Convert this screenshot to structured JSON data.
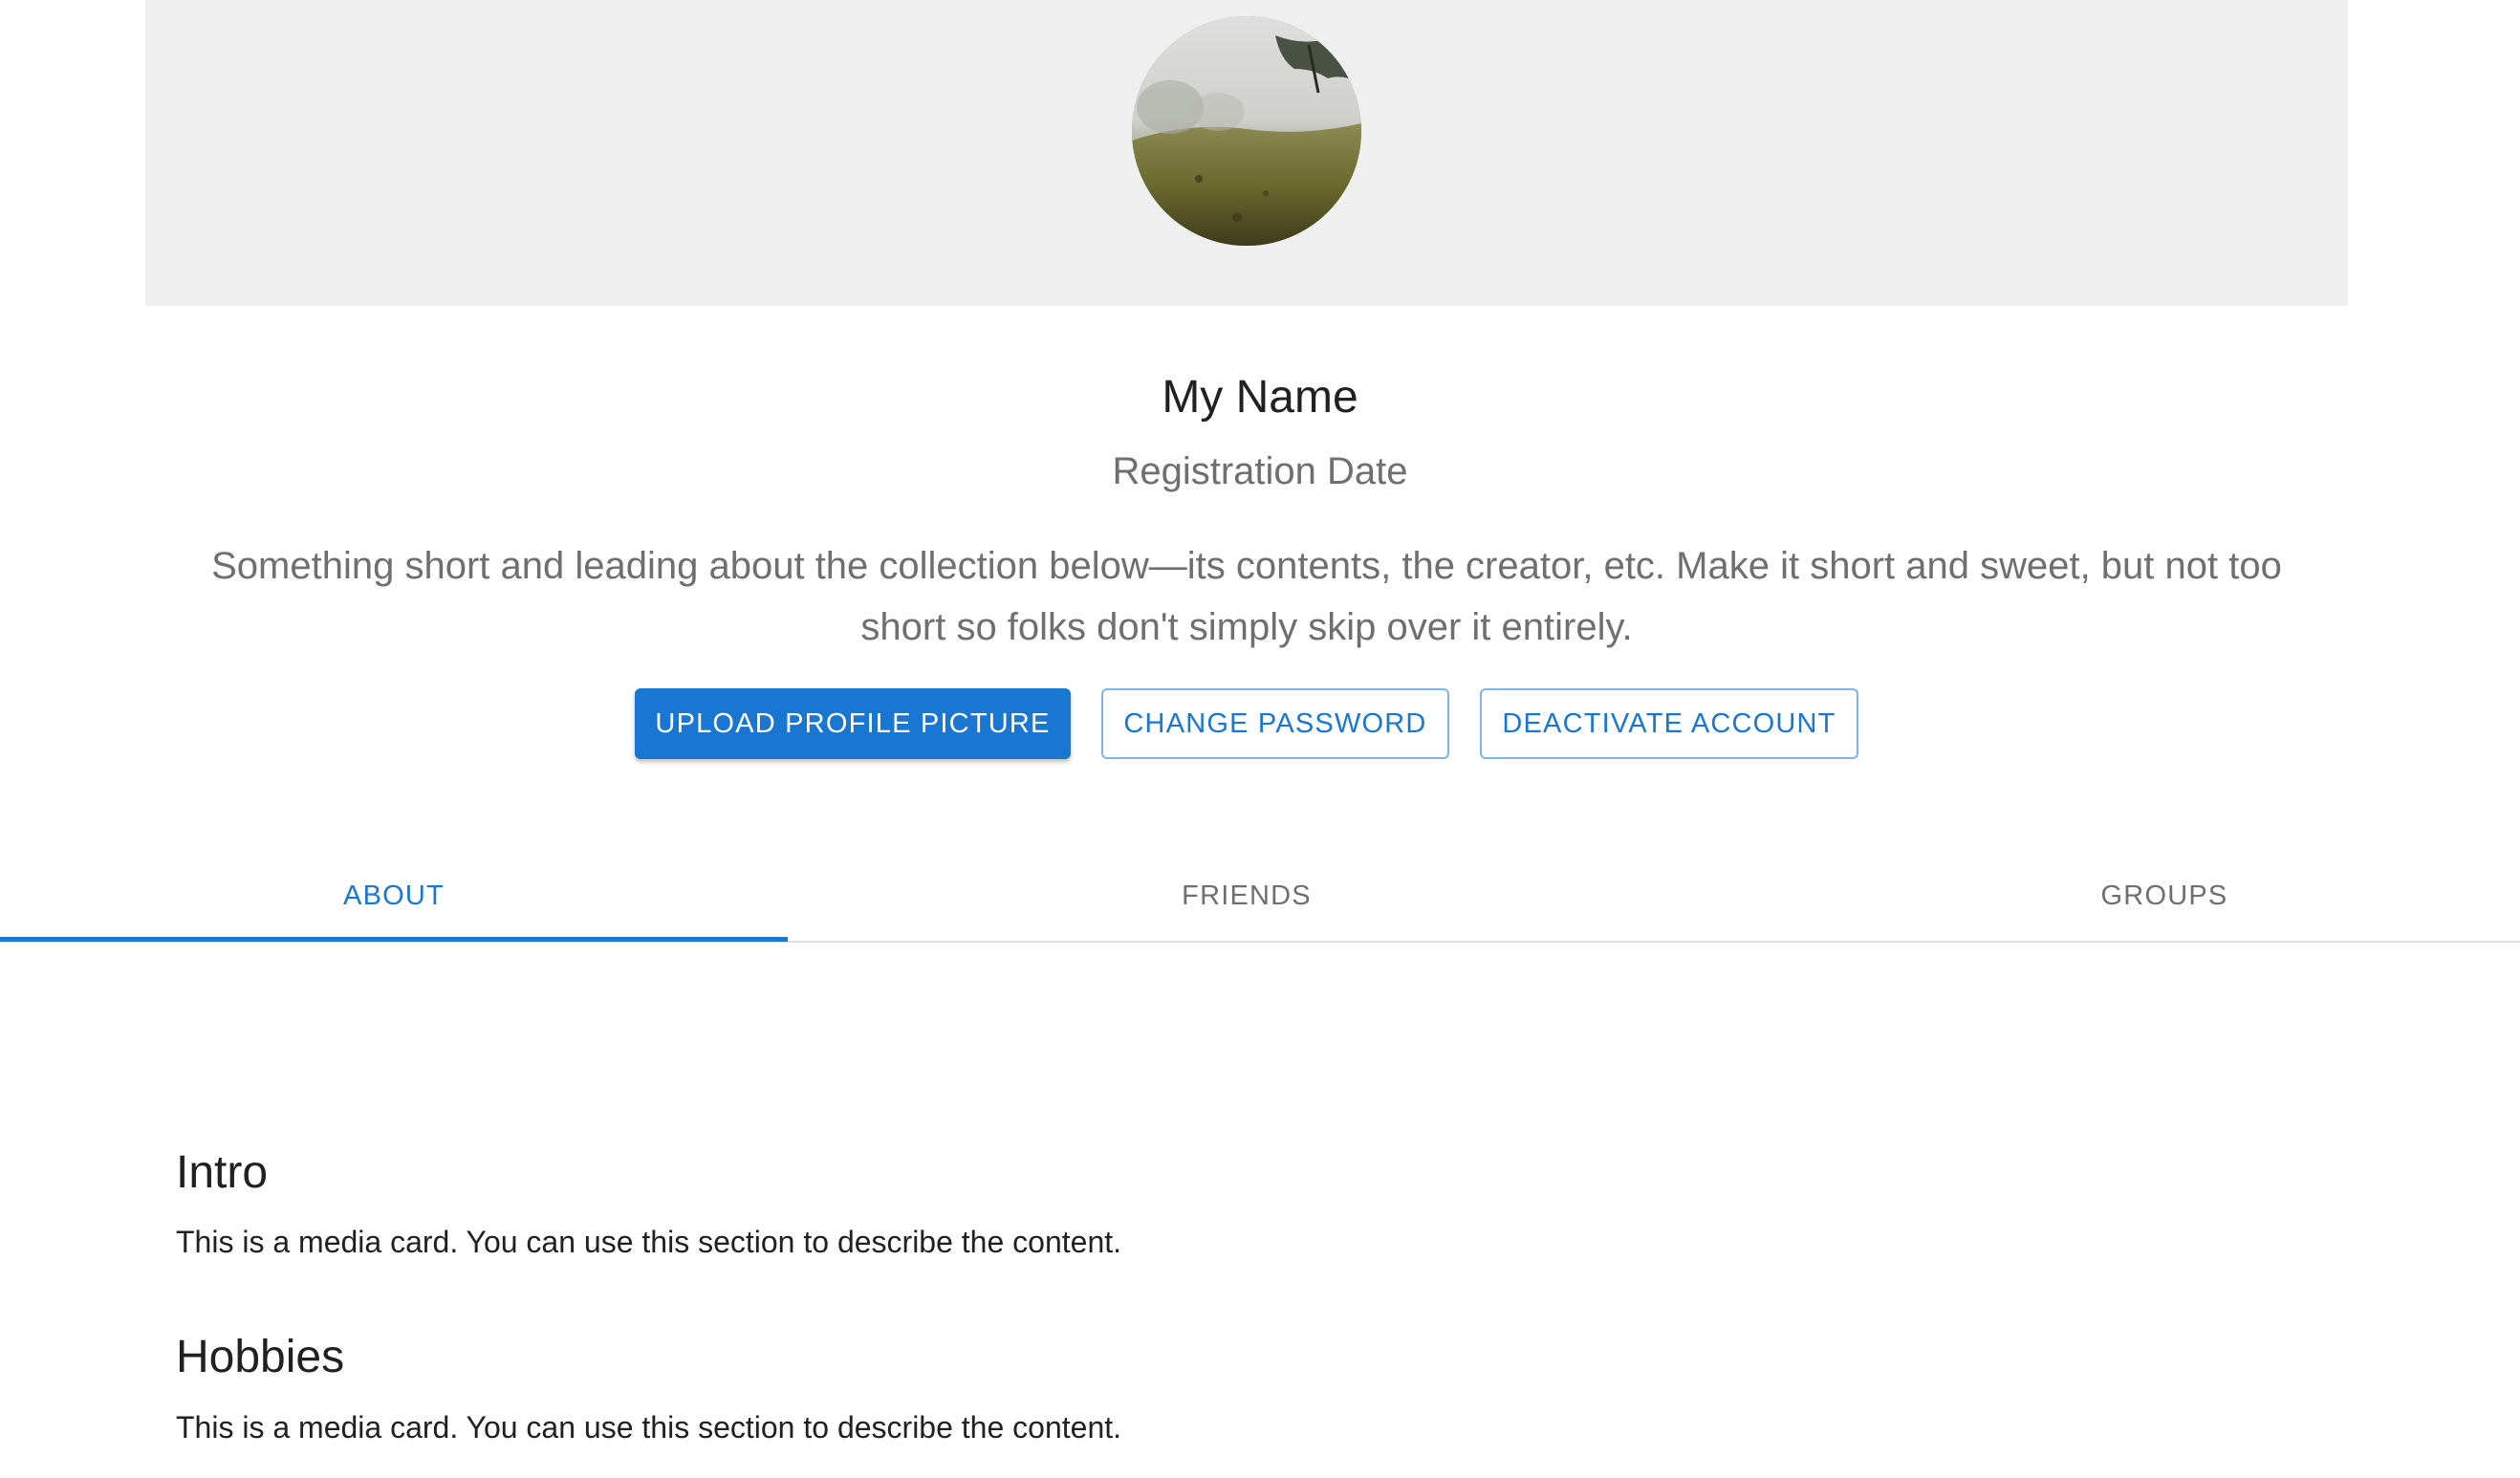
{
  "profile": {
    "name": "My Name",
    "registration_date": "Registration Date",
    "description": "Something short and leading about the collection below—its contents, the creator, etc. Make it short and sweet, but not too short so folks don't simply skip over it entirely."
  },
  "actions": {
    "upload_label": "UPLOAD PROFILE PICTURE",
    "change_password_label": "CHANGE PASSWORD",
    "deactivate_label": "DEACTIVATE ACCOUNT"
  },
  "tabs": [
    {
      "label": "ABOUT",
      "selected": true
    },
    {
      "label": "FRIENDS",
      "selected": false
    },
    {
      "label": "GROUPS",
      "selected": false
    }
  ],
  "sections": [
    {
      "title": "Intro",
      "text": "This is a media card. You can use this section to describe the content."
    },
    {
      "title": "Hobbies",
      "text": "This is a media card. You can use this section to describe the content."
    }
  ],
  "colors": {
    "primary": "#1976d2",
    "banner_bg": "#efefef",
    "secondary_text": "#6f6f6f",
    "primary_text": "#212121"
  }
}
